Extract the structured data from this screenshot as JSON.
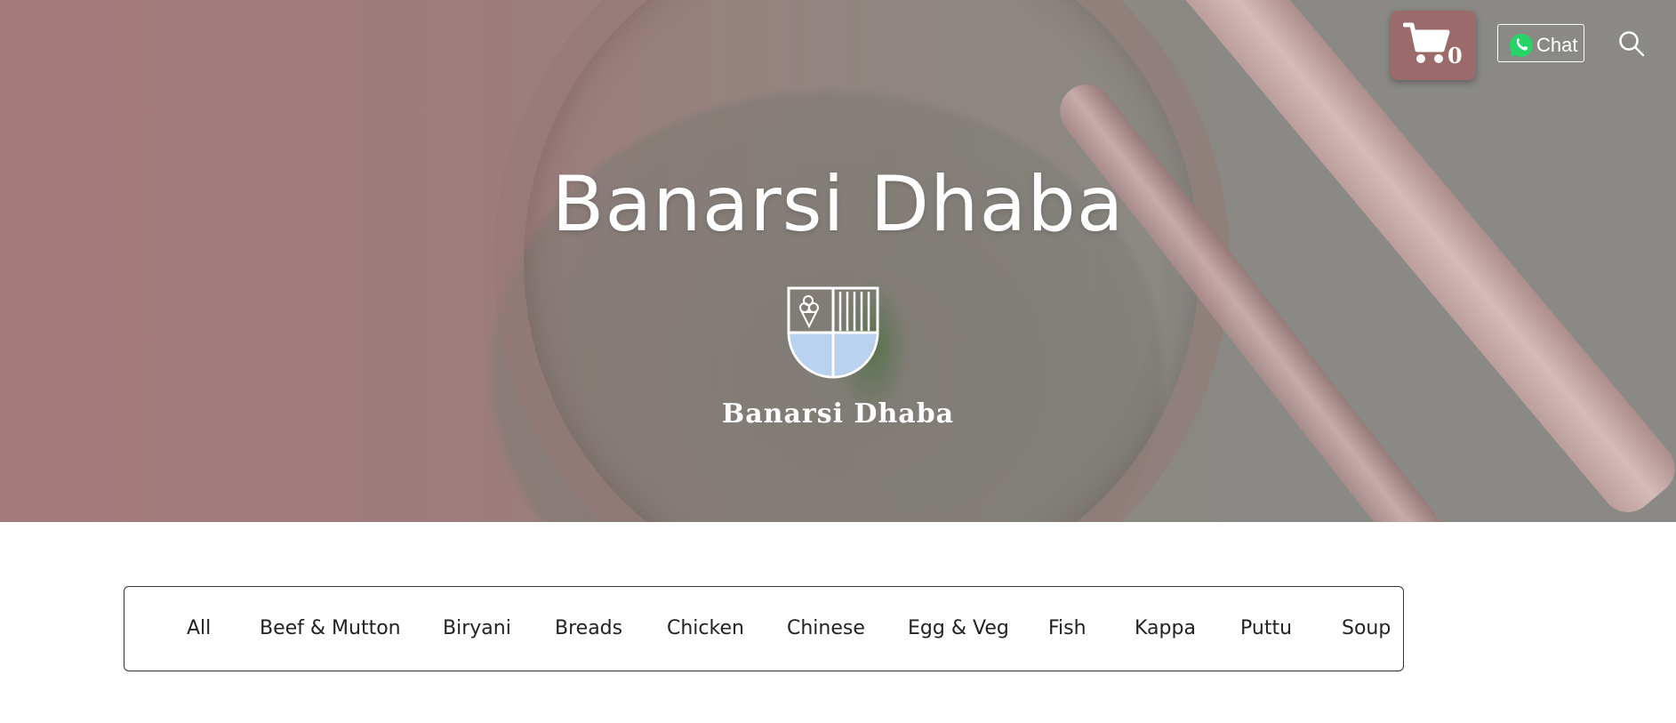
{
  "hero": {
    "title": "Banarsi Dhaba",
    "logo_text": "Banarsi Dhaba"
  },
  "header": {
    "cart_count": "0",
    "chat_label": "Chat",
    "cart_icon": "shopping-cart-icon",
    "chat_icon": "whatsapp-icon",
    "search_icon": "search-icon",
    "cart_bg": "#9b6a6b"
  },
  "categories": {
    "items": [
      "All",
      "Beef & Mutton",
      "Biryani",
      "Breads",
      "Chicken",
      "Chinese",
      "Egg & Veg",
      "Fish",
      "Kappa",
      "Puttu",
      "Soup"
    ]
  }
}
